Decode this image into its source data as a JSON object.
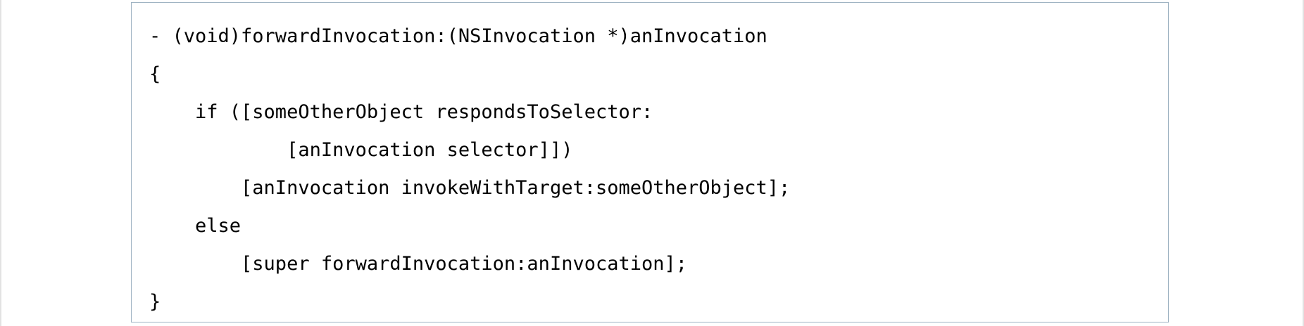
{
  "code": {
    "lines": [
      "- (void)forwardInvocation:(NSInvocation *)anInvocation",
      "{",
      "    if ([someOtherObject respondsToSelector:",
      "            [anInvocation selector]])",
      "        [anInvocation invokeWithTarget:someOtherObject];",
      "    else",
      "        [super forwardInvocation:anInvocation];",
      "}"
    ]
  }
}
